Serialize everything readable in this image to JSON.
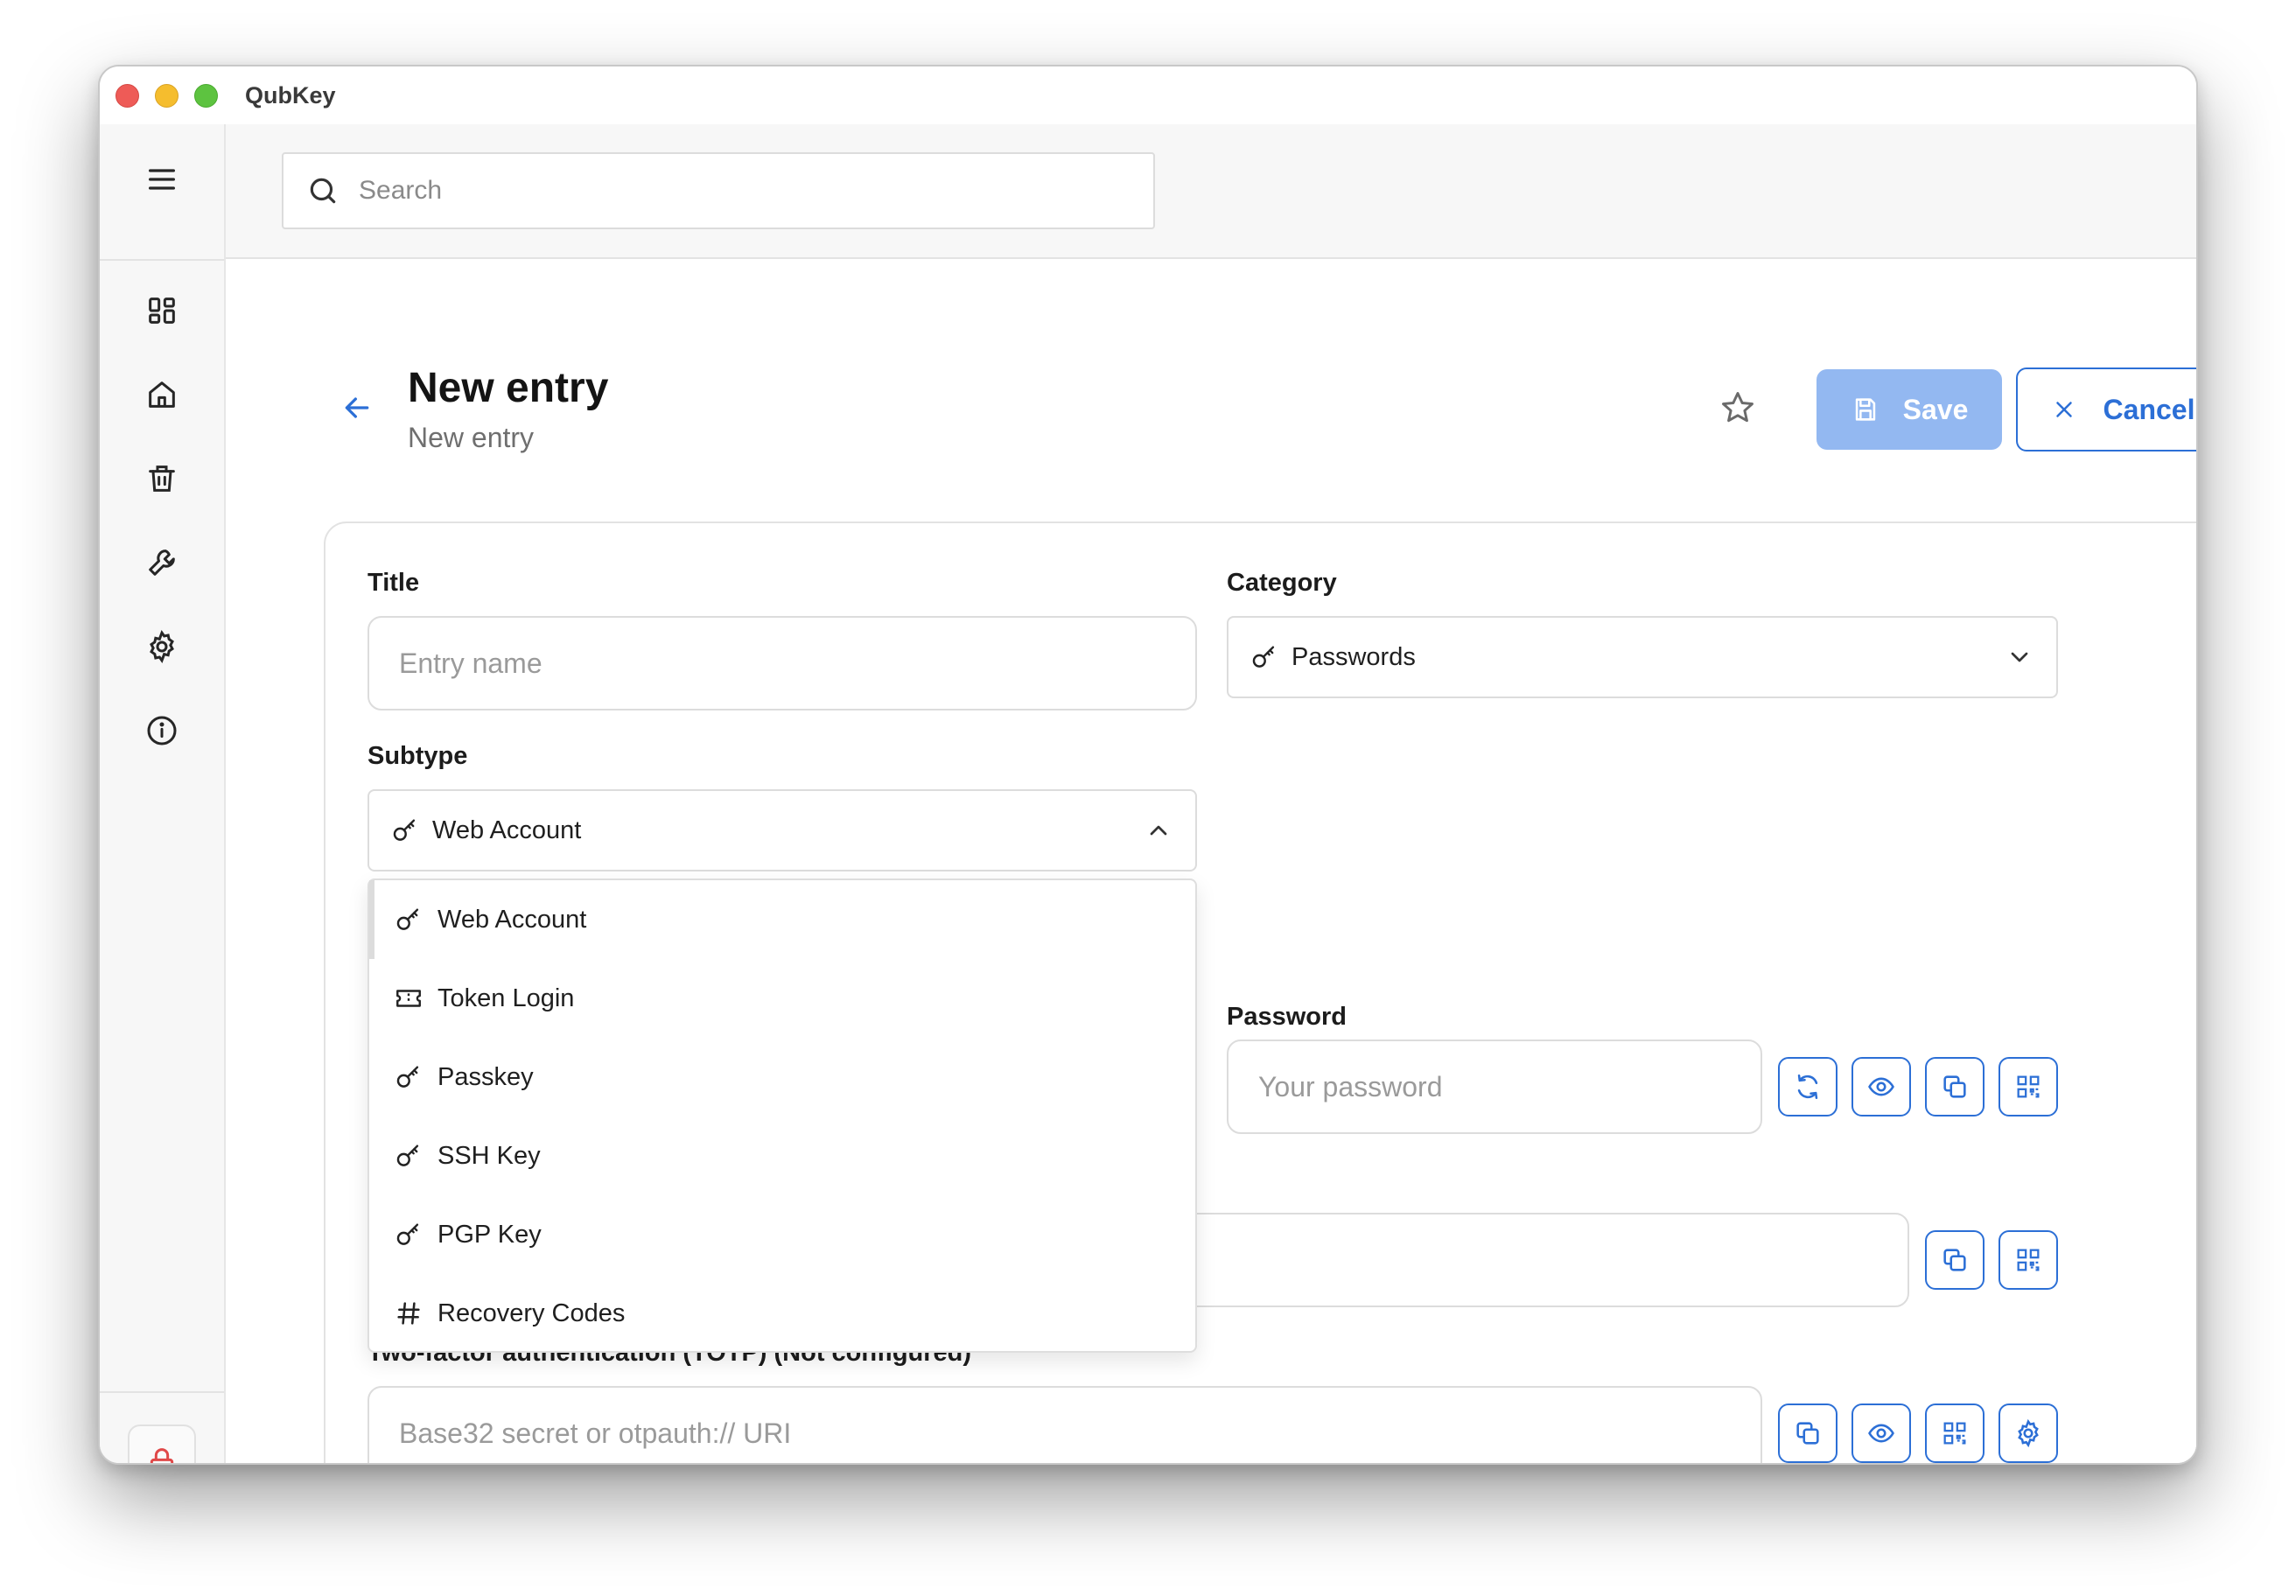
{
  "app": {
    "title": "QubKey"
  },
  "search": {
    "placeholder": "Search"
  },
  "header": {
    "title": "New entry",
    "subtitle": "New entry",
    "save_label": "Save",
    "cancel_label": "Cancel"
  },
  "form": {
    "title_label": "Title",
    "title_placeholder": "Entry name",
    "category_label": "Category",
    "category_value": "Passwords",
    "subtype_label": "Subtype",
    "subtype_value": "Web Account",
    "password_label": "Password",
    "password_placeholder": "Your password",
    "totp_label": "Two-factor authentication (TOTP) (Not configured)",
    "totp_placeholder": "Base32 secret or otpauth:// URI"
  },
  "subtype_options": [
    {
      "label": "Web Account",
      "icon": "key-icon"
    },
    {
      "label": "Token Login",
      "icon": "ticket-icon"
    },
    {
      "label": "Passkey",
      "icon": "key-icon"
    },
    {
      "label": "SSH Key",
      "icon": "key-icon"
    },
    {
      "label": "PGP Key",
      "icon": "key-icon"
    },
    {
      "label": "Recovery Codes",
      "icon": "hash-icon"
    }
  ],
  "colors": {
    "accent": "#2c6fd6",
    "save_disabled": "#93b8f1",
    "lock": "#e04848"
  }
}
